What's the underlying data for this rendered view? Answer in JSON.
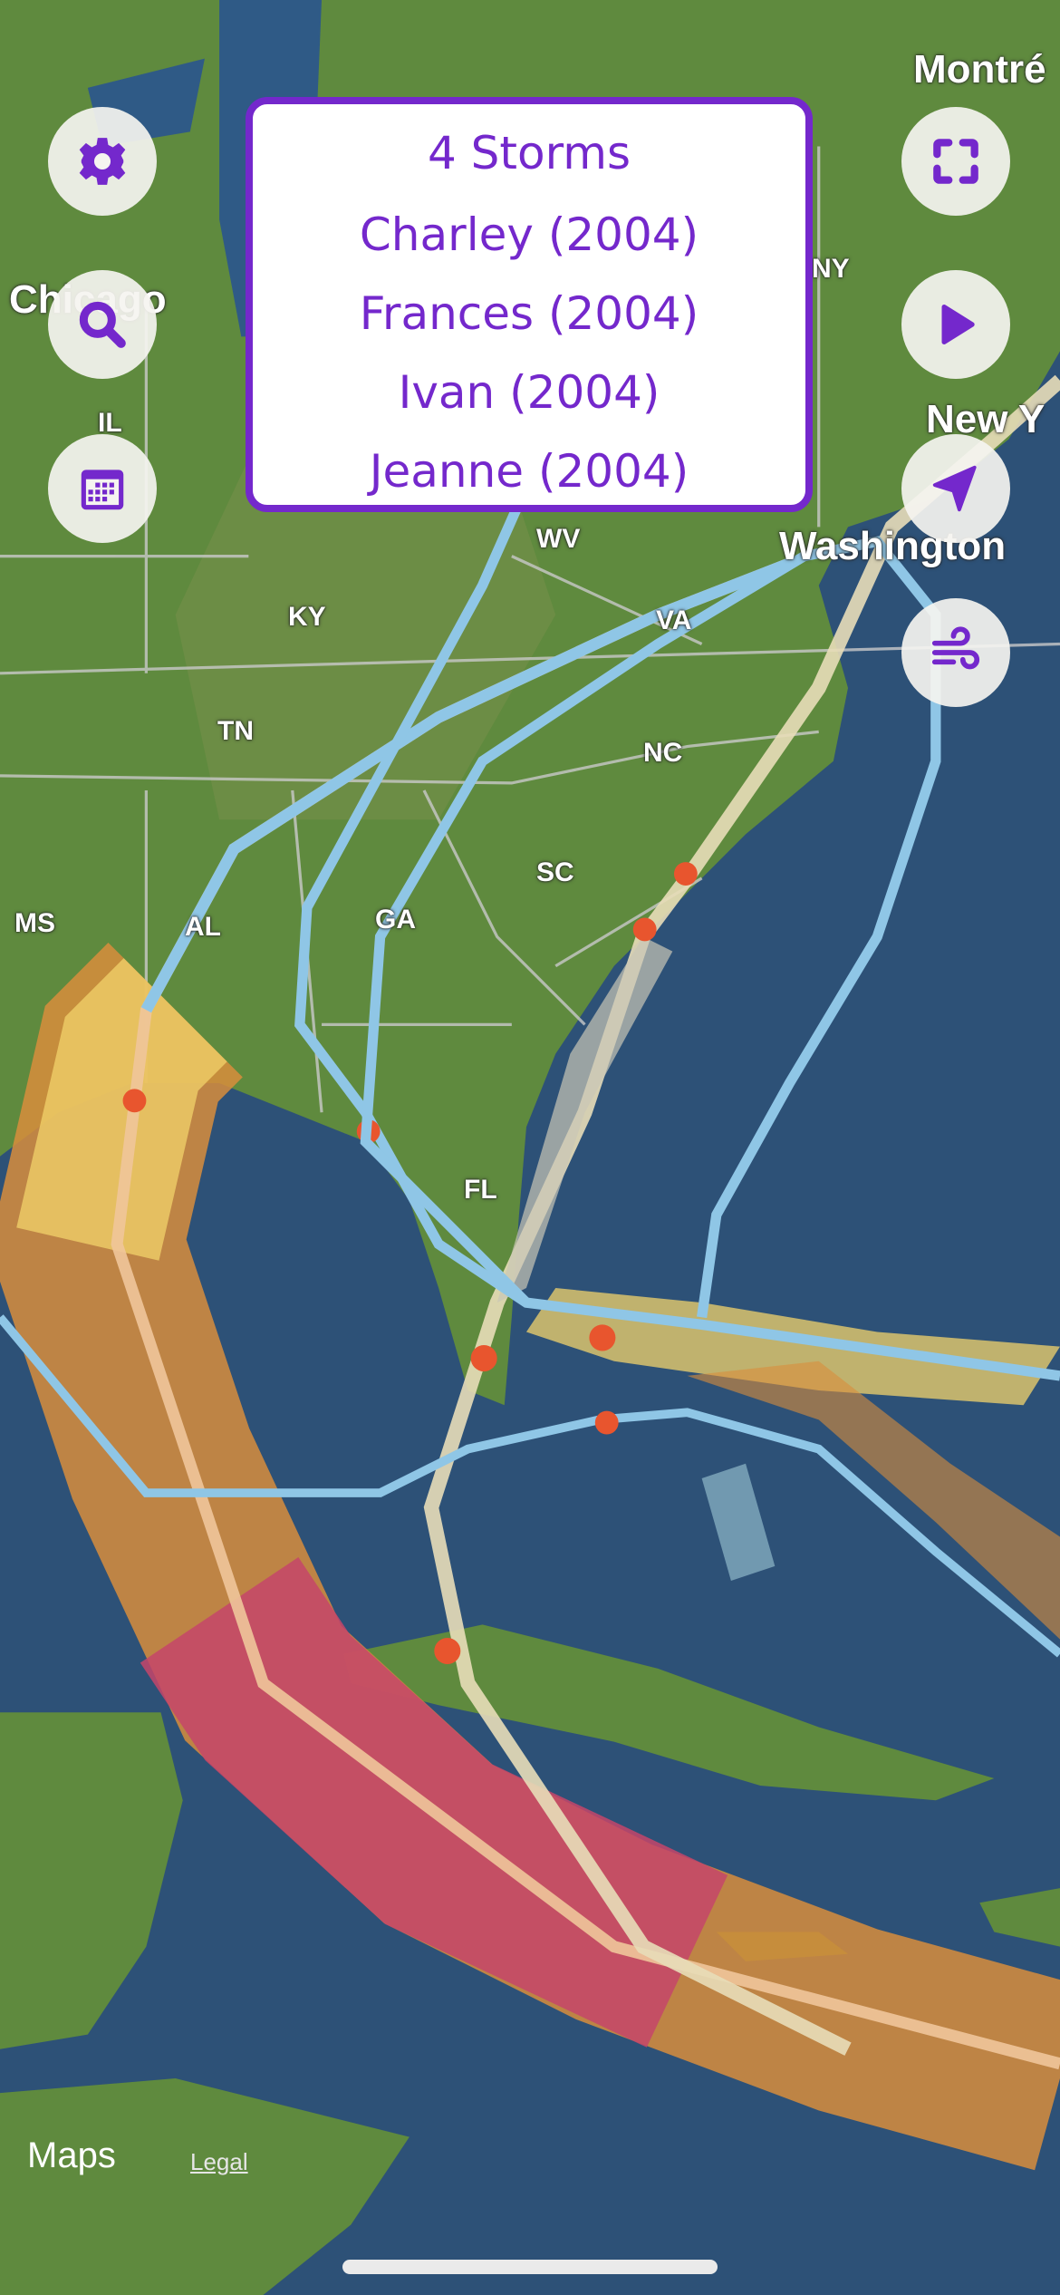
{
  "storm_panel": {
    "count_label": "4 Storms",
    "storms": [
      "Charley (2004)",
      "Frances (2004)",
      "Ivan (2004)",
      "Jeanne (2004)"
    ]
  },
  "map_labels": {
    "cities": [
      "Montré",
      "Chicago",
      "New Y",
      "Washington"
    ],
    "states": [
      "WV",
      "KY",
      "VA",
      "TN",
      "NC",
      "SC",
      "MS",
      "AL",
      "GA",
      "FL",
      "IL",
      "NY"
    ]
  },
  "left_buttons": [
    "settings",
    "search",
    "calendar"
  ],
  "right_buttons": [
    "fit-bounds",
    "play",
    "locate",
    "wind"
  ],
  "attribution": {
    "maps_label": "Maps",
    "legal_label": "Legal"
  },
  "colors": {
    "accent": "#7428cc",
    "ocean": "#2d5177",
    "land": "#5f8a3e",
    "track": "#8fc6e6",
    "cone_yellow": "#f2d36b",
    "cone_orange": "#d88d3c",
    "cone_red": "#c5456a"
  }
}
